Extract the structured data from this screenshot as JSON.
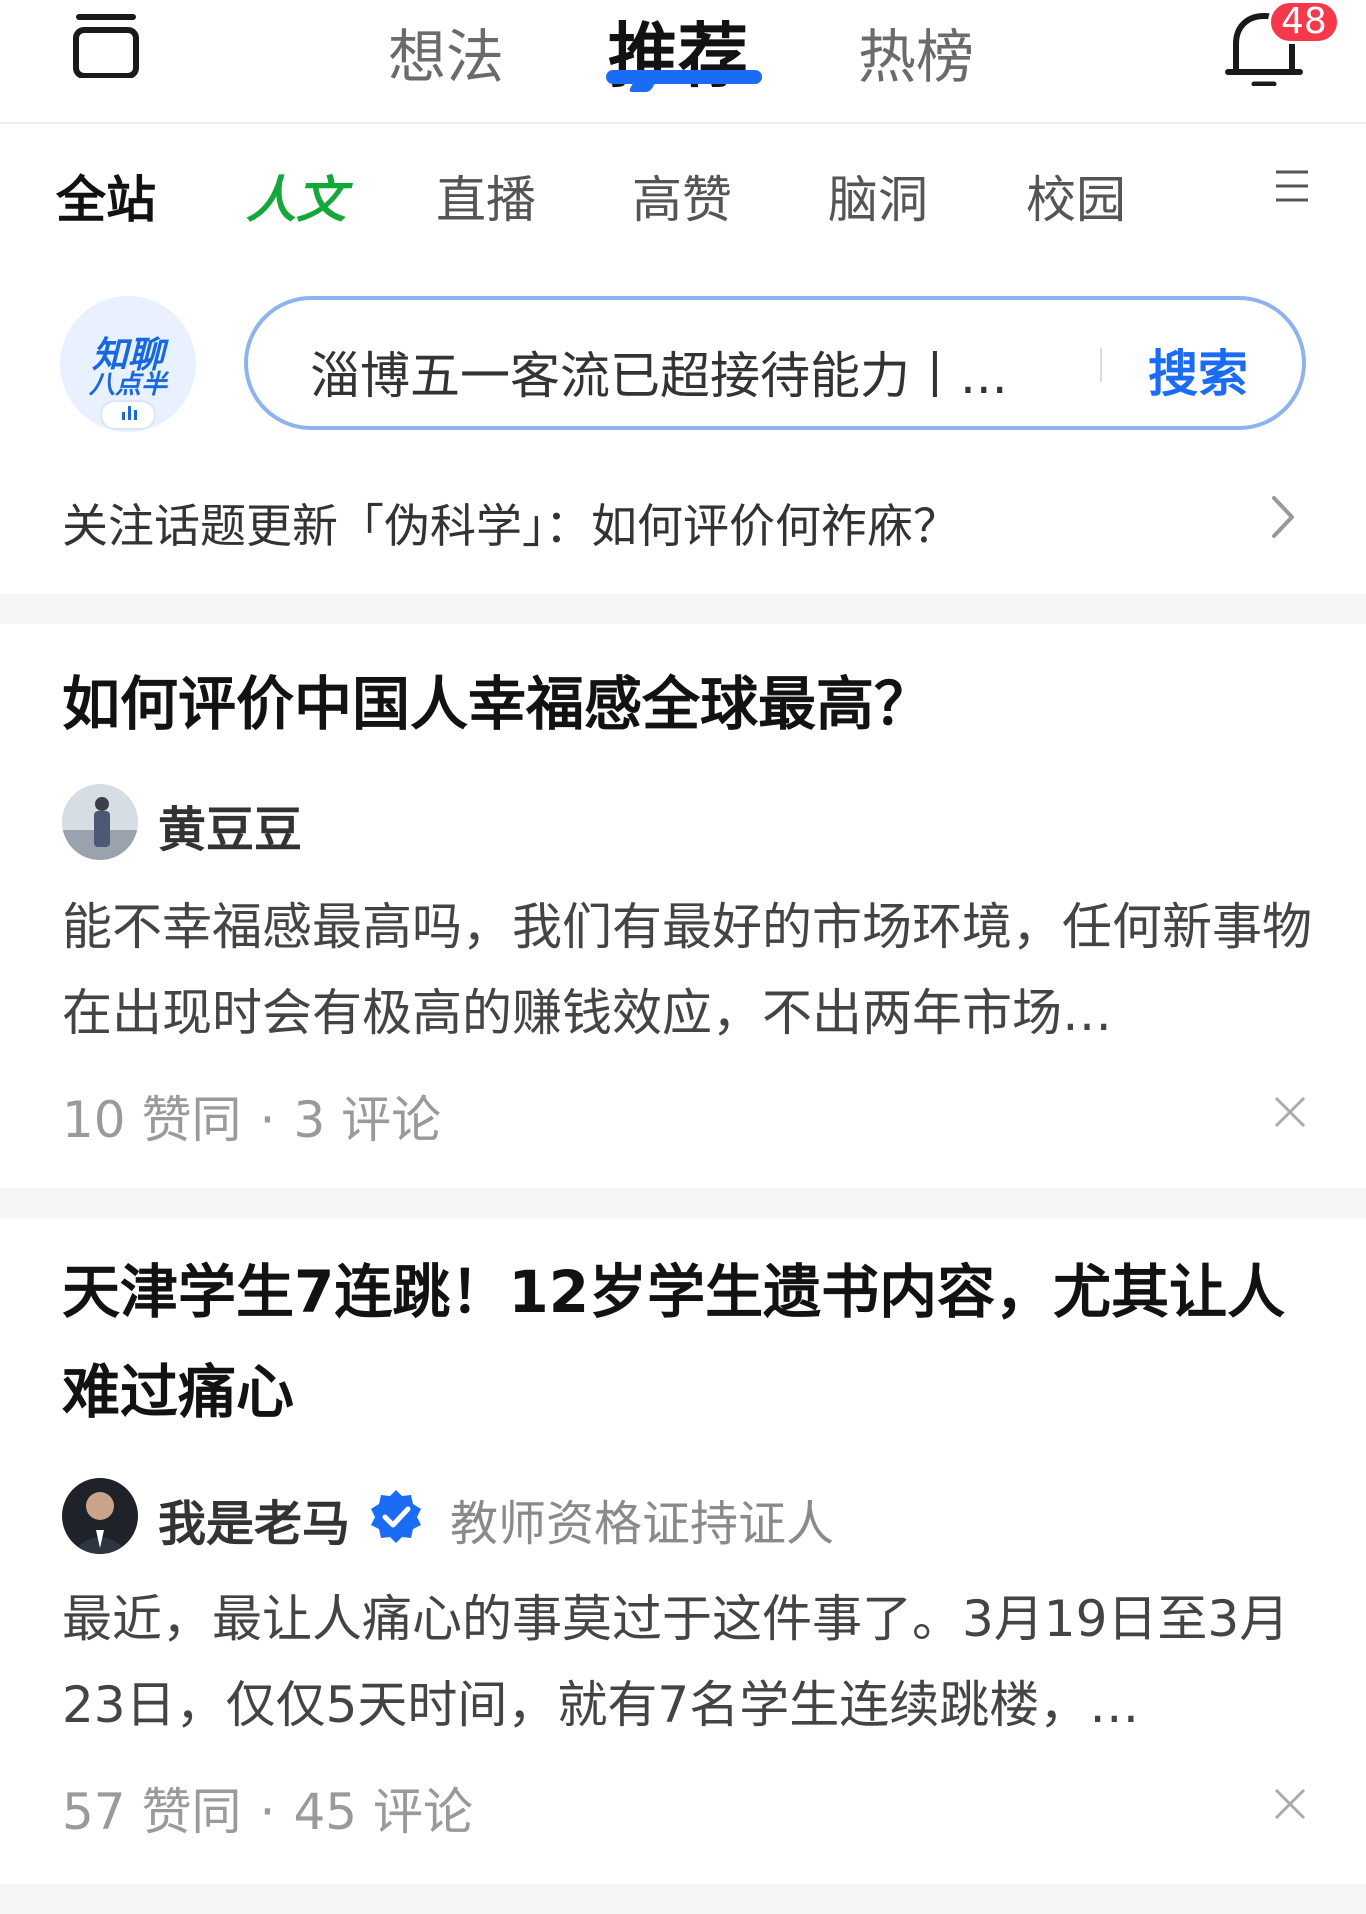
{
  "header": {
    "tabs": [
      {
        "label": "想法",
        "active": false
      },
      {
        "label": "推荐",
        "active": true
      },
      {
        "label": "热榜",
        "active": false
      }
    ],
    "notification_count": "48",
    "accent_color": "#1a6cf5"
  },
  "channels": [
    {
      "label": "全站",
      "active": true
    },
    {
      "label": "人文",
      "special": true
    },
    {
      "label": "直播"
    },
    {
      "label": "高赞"
    },
    {
      "label": "脑洞"
    },
    {
      "label": "校园"
    }
  ],
  "logo": {
    "line1": "知聊",
    "line2": "八点半"
  },
  "search": {
    "text": "淄博五一客流已超接待能力丨...",
    "button": "搜索"
  },
  "topic_update": "关注话题更新「伪科学」：如何评价何祚庥？",
  "feed": [
    {
      "title": "如何评价中国人幸福感全球最高？",
      "author": "黄豆豆",
      "verified": false,
      "author_desc": "",
      "excerpt": "能不幸福感最高吗，我们有最好的市场环境，任何新事物在出现时会有极高的赚钱效应，不出两年市场…",
      "likes": "10 赞同",
      "comments": "3 评论"
    },
    {
      "title": "天津学生7连跳！12岁学生遗书内容，尤其让人难过痛心",
      "author": "我是老马",
      "verified": true,
      "author_desc": "教师资格证持证人",
      "excerpt": "最近，最让人痛心的事莫过于这件事了。3月19日至3月23日，仅仅5天时间，就有7名学生连续跳楼，…",
      "likes": "57 赞同",
      "comments": "45 评论"
    }
  ]
}
